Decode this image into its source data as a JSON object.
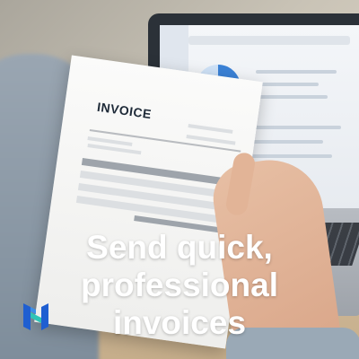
{
  "headline": {
    "line1": "Send quick,",
    "line2": "professional",
    "line3": "invoices"
  },
  "document": {
    "title": "INVOICE"
  },
  "logo": {
    "icon": "brand-logo-icon",
    "colors": [
      "#1f5fd1",
      "#2ec4b6"
    ]
  },
  "colors": {
    "headline_text": "#ffffff"
  }
}
